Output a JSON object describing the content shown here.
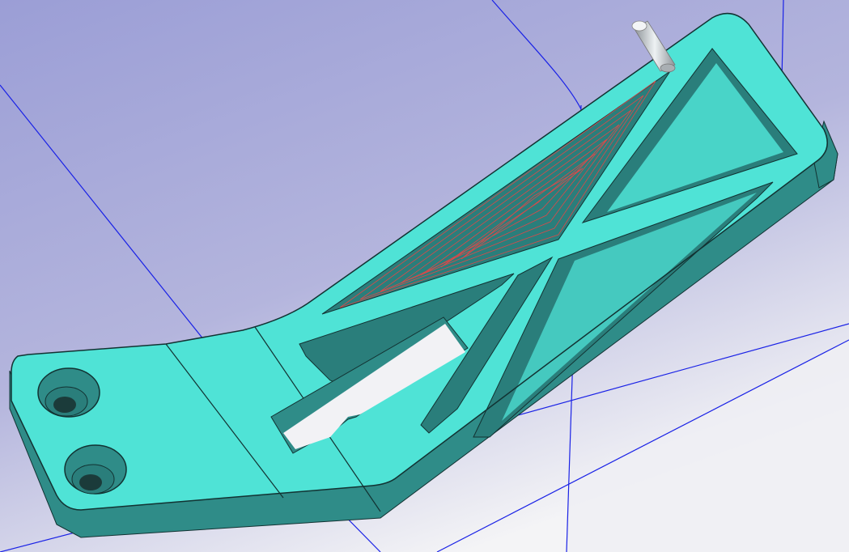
{
  "viewport": {
    "background_top": "#9b9ed6",
    "background_bottom": "#f4f4f6",
    "grid_line_color": "#1a22e6"
  },
  "part": {
    "face_color": "#4fe3d6",
    "side_color": "#2f8c88",
    "pocket_floor_color": "#2a7e7b",
    "edge_color": "#123232",
    "toolpath_color": "#d94a4a"
  },
  "tool": {
    "icon": "end-mill-tool-icon",
    "color": "#c9cfd2"
  }
}
